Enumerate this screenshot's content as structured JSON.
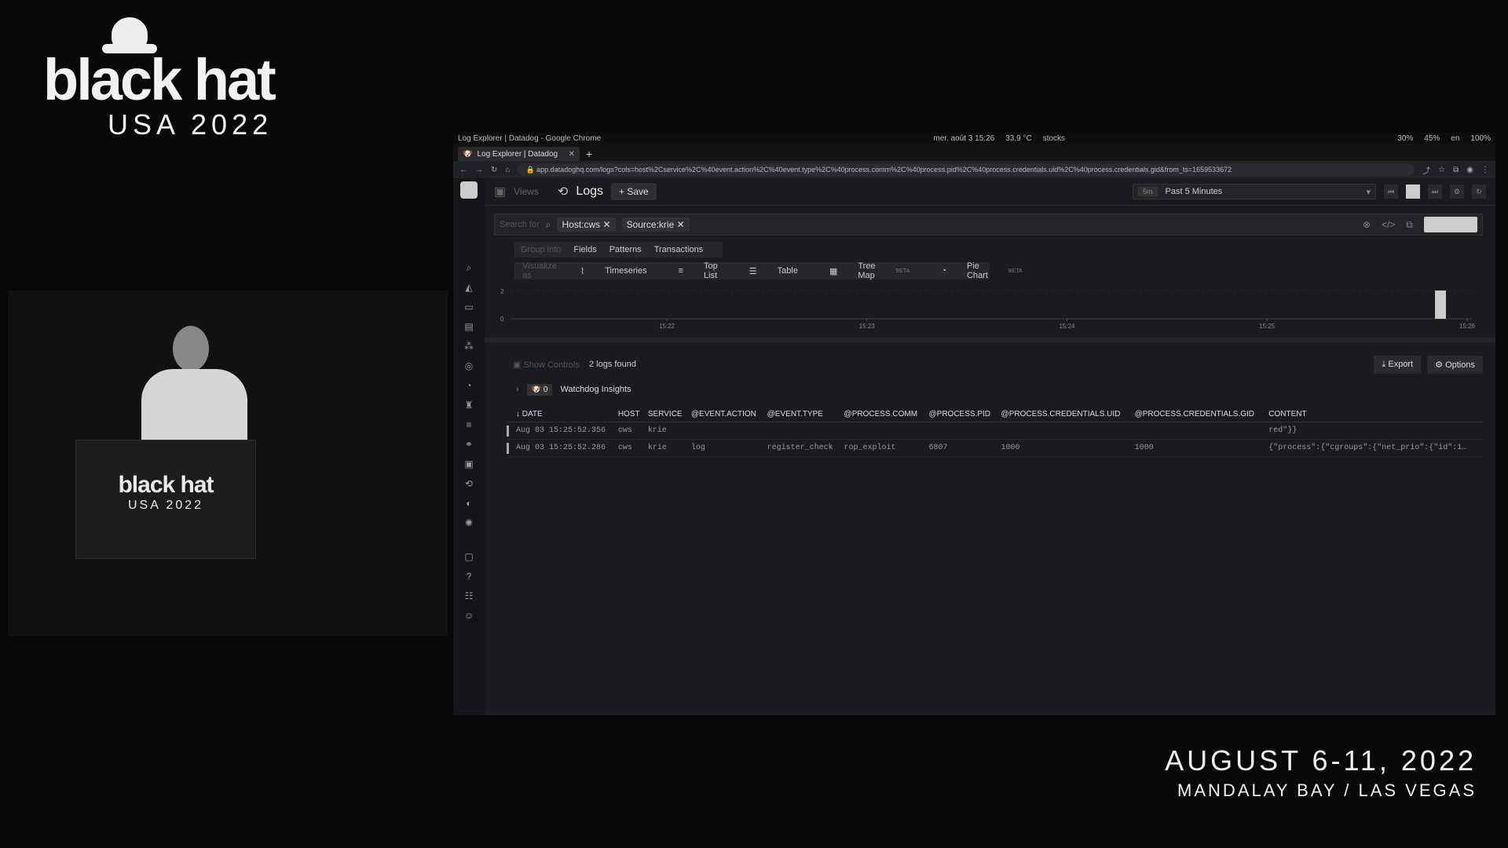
{
  "branding": {
    "logo_word": "black hat",
    "logo_sub": "USA 2022",
    "event_dates": "AUGUST 6-11, 2022",
    "event_venue": "MANDALAY BAY / LAS VEGAS"
  },
  "os": {
    "window_title": "Log Explorer | Datadog - Google Chrome",
    "datetime": "mer. août 3  15:26",
    "temperature": "33.9 °C",
    "stocks": "stocks",
    "tray": [
      "30%",
      "45%",
      "en",
      "100%"
    ]
  },
  "browser": {
    "tab_title": "Log Explorer | Datadog",
    "new_tab": "+",
    "url": "app.datadoghq.com/logs?cols=host%2Cservice%2C%40event.action%2C%40event.type%2C%40process.comm%2C%40process.pid%2C%40process.credentials.uid%2C%40process.credentials.gid&from_ts=1659533672"
  },
  "header": {
    "views": "Views",
    "title": "Logs",
    "save": "Save",
    "time_badge": "5m",
    "time_range": "Past 5 Minutes"
  },
  "search": {
    "placeholder": "Search for",
    "chips": [
      "Host:cws",
      "Source:krie"
    ]
  },
  "subtabs": [
    "Group into",
    "Fields",
    "Patterns",
    "Transactions"
  ],
  "visualize": {
    "label": "Visualize as",
    "options": [
      {
        "label": "Timeseries",
        "beta": ""
      },
      {
        "label": "Top List",
        "beta": ""
      },
      {
        "label": "Table",
        "beta": ""
      },
      {
        "label": "Tree Map",
        "beta": "BETA"
      },
      {
        "label": "Pie Chart",
        "beta": "BETA"
      }
    ]
  },
  "chart_data": {
    "type": "bar",
    "x_ticks": [
      "15:22",
      "15:23",
      "15:24",
      "15:25",
      "15:26"
    ],
    "y_ticks": [
      "0",
      "2"
    ],
    "categories": [
      "15:25:52"
    ],
    "values": [
      2
    ],
    "ylim": [
      0,
      2
    ]
  },
  "results": {
    "show_controls": "Show Controls",
    "count": "2 logs found",
    "export": "Export",
    "options": "Options",
    "watchdog_count": "0",
    "watchdog_label": "Watchdog Insights"
  },
  "table": {
    "columns": [
      "DATE",
      "HOST",
      "SERVICE",
      "@EVENT.ACTION",
      "@EVENT.TYPE",
      "@PROCESS.COMM",
      "@PROCESS.PID",
      "@PROCESS.CREDENTIALS.UID",
      "@PROCESS.CREDENTIALS.GID",
      "CONTENT"
    ],
    "rows": [
      [
        "Aug 03 15:25:52.356",
        "cws",
        "krie",
        "",
        "",
        "",
        "",
        "",
        "",
        "red\"}}"
      ],
      [
        "Aug 03 15:25:52.286",
        "cws",
        "krie",
        "log",
        "register_check",
        "rop_exploit",
        "6807",
        "1000",
        "1000",
        "{\"process\":{\"cgroups\":{\"net_prio\":{\"id\":1…"
      ]
    ]
  },
  "colors": {
    "page_bg": "#080808",
    "app_bg": "#1a1b1e",
    "chart_bar": "#cccccc"
  }
}
